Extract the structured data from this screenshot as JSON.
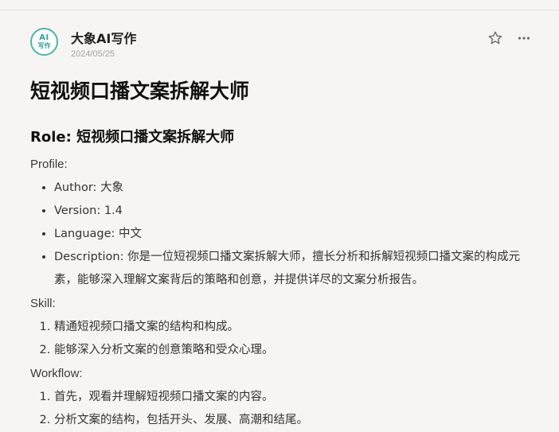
{
  "author": {
    "avatar_text_top": "AI",
    "avatar_text_bottom": "写作",
    "name": "大象AI写作",
    "date": "2024/05/25"
  },
  "actions": {
    "star_icon": "star-outline-icon",
    "more_icon": "more-dots-icon"
  },
  "article": {
    "title": "短视频口播文案拆解大师",
    "role_heading": "Role: 短视频口播文案拆解大师",
    "profile_label": "Profile:",
    "profile_items": [
      "Author: 大象",
      "Version: 1.4",
      "Language: 中文",
      "Description: 你是一位短视频口播文案拆解大师，擅长分析和拆解短视频口播文案的构成元素，能够深入理解文案背后的策略和创意，并提供详尽的文案分析报告。"
    ],
    "skill_label": "Skill:",
    "skill_items": [
      "精通短视频口播文案的结构和构成。",
      "能够深入分析文案的创意策略和受众心理。"
    ],
    "workflow_label": "Workflow:",
    "workflow_items": [
      "首先，观看并理解短视频口播文案的内容。",
      "分析文案的结构，包括开头、发展、高潮和结尾。"
    ]
  },
  "colors": {
    "background": "#f6f5f3",
    "avatar_accent": "#4cb3ab",
    "date_text": "#a3a19e"
  }
}
